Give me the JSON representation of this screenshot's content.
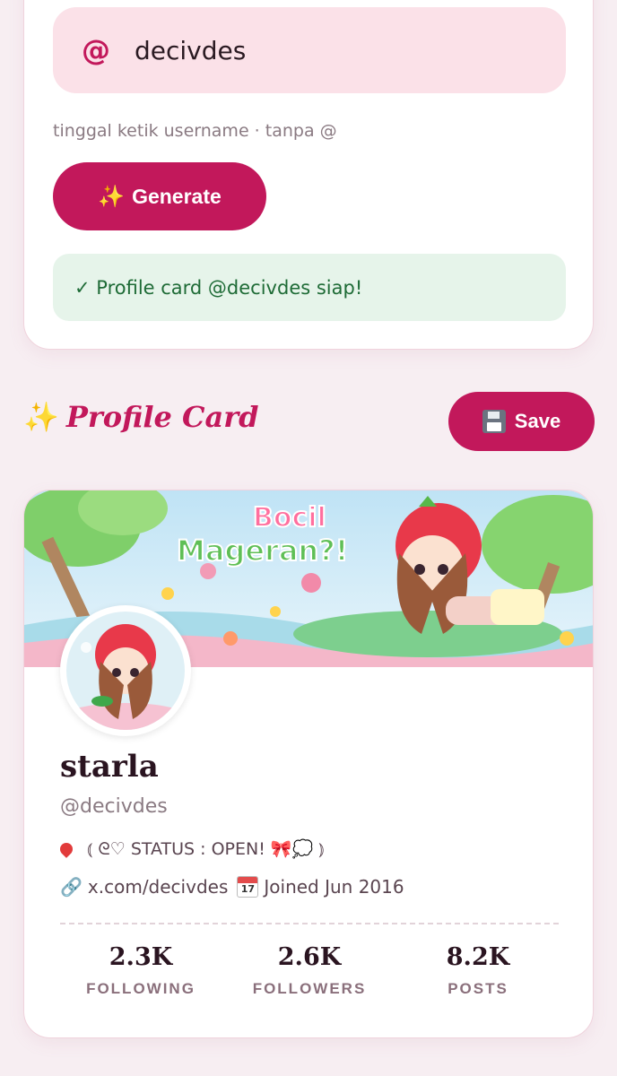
{
  "form": {
    "username_value": "decivdes",
    "at_symbol": "@",
    "hint": "tinggal ketik username · tanpa @",
    "generate_icon": "✨",
    "generate_label": "Generate",
    "success_message": "✓ Profile card @decivdes siap!"
  },
  "section": {
    "icon": "✨",
    "title": "Profile Card",
    "save_label": "Save",
    "save_icon": "floppy-disk-icon"
  },
  "banner": {
    "text_line1": "Bocil",
    "text_line2": "Mageran?!"
  },
  "profile": {
    "display_name": "starla",
    "handle": "@decivdes",
    "bio": "⦅ ᘓ♡  STATUS  :  OPEN!  🎀💭  ⦆",
    "link": "x.com/decivdes",
    "joined": "Joined Jun 2016",
    "calendar_day": "17"
  },
  "stats": [
    {
      "value": "2.3K",
      "label": "FOLLOWING"
    },
    {
      "value": "2.6K",
      "label": "FOLLOWERS"
    },
    {
      "value": "8.2K",
      "label": "POSTS"
    }
  ],
  "colors": {
    "accent": "#c2185b",
    "input_bg": "#fbe1e8",
    "success_bg": "#e6f4ea",
    "success_text": "#1e6b36",
    "page_bg": "#f7eef2"
  }
}
